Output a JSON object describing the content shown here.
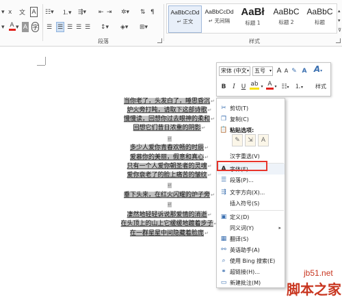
{
  "ribbon": {
    "paragraph_group": "段落",
    "styles_group": "样式",
    "styles": [
      {
        "preview": "AaBbCcDd",
        "name": "↵ 正文"
      },
      {
        "preview": "AaBbCcDd",
        "name": "↵ 无间隔"
      },
      {
        "preview": "AaBł",
        "name": "标题 1"
      },
      {
        "preview": "AaBbC",
        "name": "标题 2"
      },
      {
        "preview": "AaBbC",
        "name": "标题"
      }
    ]
  },
  "poem": [
    "当你老了，头发白了，睡思昏沉",
    "炉火旁打盹，请取下这部诗歌",
    "慢慢读，回想你过去眼神的柔和",
    "回想它们昔日浓重的阴影",
    "",
    "多少人爱你青春欢畅的时辰",
    "爱慕你的美丽，假意和真心",
    "只有一个人爱你朝圣者的灵魂",
    "爱你衰老了的脸上痛苦的皱纹",
    "",
    "垂下头来，在红火闪耀的炉子旁",
    "",
    "凄然地轻轻诉说那爱情的消逝",
    "在头顶上的山上它缓缓地踱着步子",
    "在一群星星中间隐藏着脸庞"
  ],
  "mini_toolbar": {
    "font_name": "宋体 (中文",
    "font_size": "五号",
    "grow_font": "A",
    "shrink_font": "A",
    "bold": "B",
    "italic": "I",
    "underline": "U",
    "styles_label": "样式"
  },
  "menu": {
    "cut": "剪切(T)",
    "copy": "复制(C)",
    "paste_options": "粘贴选项:",
    "hanzi_reselect": "汉字重选(V)",
    "font": "字体(F)...",
    "paragraph": "段落(P)...",
    "text_direction": "文字方向(X)...",
    "insert_symbol": "插入符号(S)",
    "define": "定义(D)",
    "synonyms": "同义词(Y)",
    "translate": "翻译(S)",
    "english_assistant": "英语助手(A)",
    "bing_search": "使用 Bing 搜索(E)",
    "hyperlink": "超链接(H)...",
    "new_comment": "新建批注(M)"
  },
  "watermark": {
    "site": "jb51.net",
    "brand": "脚本之家"
  },
  "colors": {
    "selection": "#c2c2c2",
    "highlight_border": "#e8342b",
    "accent": "#3a6fb0",
    "font_color_mark": "#e0201a",
    "highlight_mark": "#f7e000",
    "watermark": "#c8351f"
  }
}
